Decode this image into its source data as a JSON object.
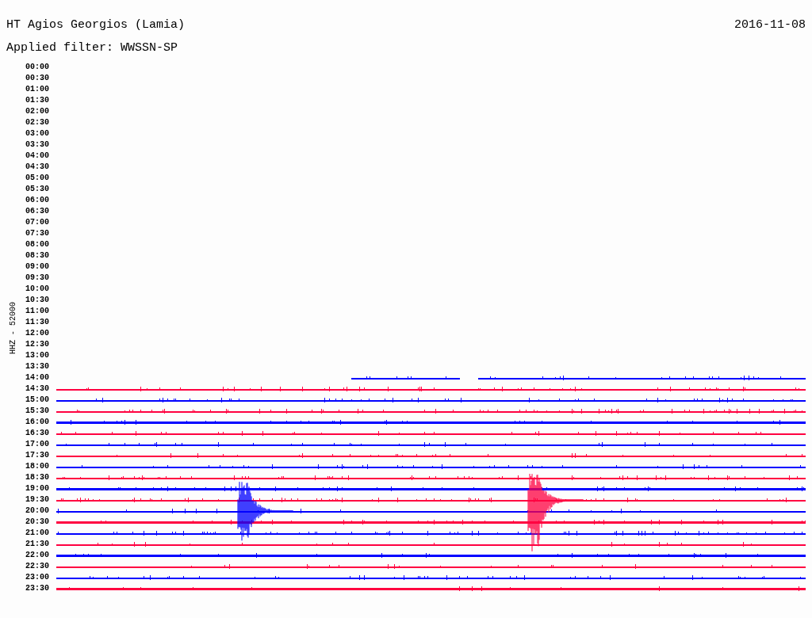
{
  "header": {
    "station": "HT Agios Georgios (Lamia)",
    "date": "2016-11-08",
    "filter": "Applied filter: WWSSN-SP"
  },
  "channel_label": "HHZ - 52000",
  "rows": [
    {
      "time": "00:00"
    },
    {
      "time": "00:30"
    },
    {
      "time": "01:00"
    },
    {
      "time": "01:30"
    },
    {
      "time": "02:00"
    },
    {
      "time": "02:30"
    },
    {
      "time": "03:00"
    },
    {
      "time": "03:30"
    },
    {
      "time": "04:00"
    },
    {
      "time": "04:30"
    },
    {
      "time": "05:00"
    },
    {
      "time": "05:30"
    },
    {
      "time": "06:00"
    },
    {
      "time": "06:30"
    },
    {
      "time": "07:00"
    },
    {
      "time": "07:30"
    },
    {
      "time": "08:00"
    },
    {
      "time": "08:30"
    },
    {
      "time": "09:00"
    },
    {
      "time": "09:30"
    },
    {
      "time": "10:00"
    },
    {
      "time": "10:30"
    },
    {
      "time": "11:00"
    },
    {
      "time": "11:30"
    },
    {
      "time": "12:00"
    },
    {
      "time": "12:30"
    },
    {
      "time": "13:00"
    },
    {
      "time": "13:30"
    },
    {
      "time": "14:00",
      "trace": {
        "kind": "partial",
        "color": "#0000ff"
      }
    },
    {
      "time": "14:30",
      "trace": {
        "kind": "full",
        "color": "#ff0040"
      }
    },
    {
      "time": "15:00",
      "trace": {
        "kind": "full",
        "color": "#0000ff"
      }
    },
    {
      "time": "15:30",
      "trace": {
        "kind": "full",
        "color": "#ff0040"
      }
    },
    {
      "time": "16:00",
      "trace": {
        "kind": "full",
        "color": "#0000ff"
      }
    },
    {
      "time": "16:30",
      "trace": {
        "kind": "full",
        "color": "#ff0040"
      }
    },
    {
      "time": "17:00",
      "trace": {
        "kind": "full",
        "color": "#0000ff"
      }
    },
    {
      "time": "17:30",
      "trace": {
        "kind": "full",
        "color": "#ff0040"
      }
    },
    {
      "time": "18:00",
      "trace": {
        "kind": "full",
        "color": "#0000ff"
      }
    },
    {
      "time": "18:30",
      "trace": {
        "kind": "full",
        "color": "#ff0040"
      }
    },
    {
      "time": "19:00",
      "trace": {
        "kind": "full",
        "color": "#0000ff"
      }
    },
    {
      "time": "19:30",
      "trace": {
        "kind": "full",
        "color": "#ff0040"
      }
    },
    {
      "time": "20:00",
      "trace": {
        "kind": "full",
        "color": "#0000ff"
      }
    },
    {
      "time": "20:30",
      "trace": {
        "kind": "full",
        "color": "#ff0040"
      }
    },
    {
      "time": "21:00",
      "trace": {
        "kind": "full",
        "color": "#0000ff"
      }
    },
    {
      "time": "21:30",
      "trace": {
        "kind": "full",
        "color": "#ff0040"
      }
    },
    {
      "time": "22:00",
      "trace": {
        "kind": "full",
        "color": "#0000ff"
      }
    },
    {
      "time": "22:30",
      "trace": {
        "kind": "full",
        "color": "#ff0040"
      }
    },
    {
      "time": "23:00",
      "trace": {
        "kind": "full",
        "color": "#0000ff"
      }
    },
    {
      "time": "23:30",
      "trace": {
        "kind": "full",
        "color": "#ff0040"
      }
    }
  ]
}
